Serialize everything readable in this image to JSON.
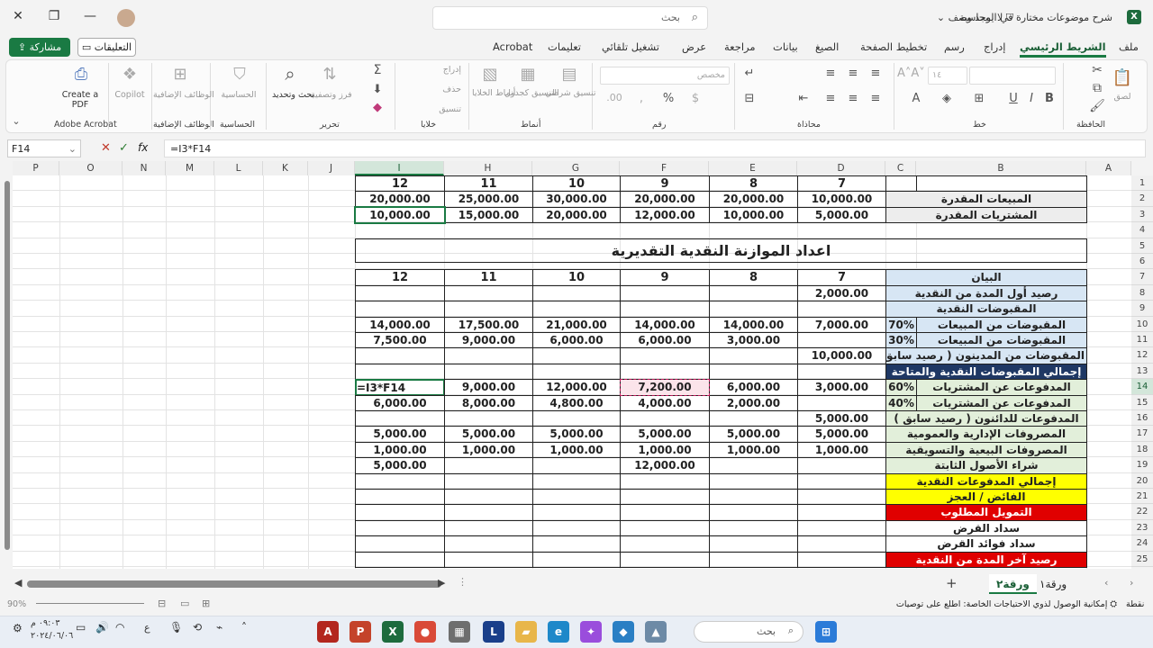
{
  "window": {
    "title": "شرح موضوعات مختارة في المحاسبة",
    "sensitivity": "لا يوجد وصف",
    "search_placeholder": "بحث",
    "app_logo": "X"
  },
  "tabs": [
    "ملف",
    "الشريط الرئيسي",
    "إدراج",
    "رسم",
    "تخطيط الصفحة",
    "الصيغ",
    "بيانات",
    "مراجعة",
    "عرض",
    "تشغيل تلقائي",
    "تعليمات",
    "Acrobat"
  ],
  "actions": {
    "share": "مشاركة",
    "comments": "التعليقات"
  },
  "ribbon": {
    "groups": [
      "الحافظة",
      "خط",
      "محاذاة",
      "رقم",
      "أنماط",
      "خلايا",
      "تحرير",
      "الحساسية",
      "الوظائف الإضافية",
      "Adobe Acrobat"
    ],
    "paste": "لصق",
    "font_size": "١٤",
    "number_format": "مخصص",
    "cond_format": "تنسيق شرطي",
    "format_table": "التنسيق كجدول",
    "cell_styles": "أنماط الخلايا",
    "insert": "إدراج",
    "delete": "حذف",
    "format": "تنسيق",
    "sort_filter": "فرز وتصفية",
    "find_select": "بحث وتحديد",
    "sensitivity": "الحساسية",
    "addins": "الوظائف الإضافية",
    "copilot": "Copilot",
    "create_pdf": "Create a PDF"
  },
  "formula_bar": {
    "name_box": "F14",
    "formula": "=I3*F14",
    "fx": "fx"
  },
  "columns": [
    "P",
    "O",
    "N",
    "M",
    "L",
    "K",
    "J",
    "I",
    "H",
    "G",
    "F",
    "E",
    "D",
    "C",
    "B",
    "A"
  ],
  "rows": [
    "1",
    "2",
    "3",
    "4",
    "5",
    "6",
    "7",
    "8",
    "9",
    "10",
    "11",
    "12",
    "13",
    "14",
    "15",
    "16",
    "17",
    "18",
    "19",
    "20",
    "21",
    "22",
    "23",
    "24",
    "25"
  ],
  "sheet": {
    "months": [
      "12",
      "11",
      "10",
      "9",
      "8",
      "7"
    ],
    "sales_label": "المبيعات المقدرة",
    "sales": [
      "20,000.00",
      "25,000.00",
      "30,000.00",
      "20,000.00",
      "20,000.00",
      "10,000.00"
    ],
    "purchases_label": "المشتريات المقدرة",
    "purchases": [
      "10,000.00",
      "15,000.00",
      "20,000.00",
      "12,000.00",
      "10,000.00",
      "5,000.00"
    ],
    "title": "اعداد الموازنة النقدية التقديرية",
    "desc_header": "البيان",
    "labels": [
      "رصيد أول المدة من النقدية",
      "المقبوضات النقدية",
      "المقبوضات من المبيعات",
      "المقبوضات من المبيعات",
      "المقبوضات من المدينون ( رصيد سابق )",
      "إجمالي المقبوضات النقدية والمتاحة",
      "المدفوعات عن المشتريات",
      "المدفوعات عن المشتريات",
      "المدفوعات للدائنون ( رصيد سابق )",
      "المصروفات الإدارية والعمومية",
      "المصروفات البيعية والتسويقية",
      "شراء الأصول الثابتة",
      "إجمالي المدفوعات النقدية",
      "الفائض / العجز",
      "التمويل المطلوب",
      "سداد القرض",
      "سداد فوائد القرض",
      "رصيد آخر المدة من النقدية"
    ],
    "pct": {
      "r10": "70%",
      "r11": "30%",
      "r14": "60%",
      "r15": "40%"
    },
    "r8": [
      "",
      "",
      "",
      "",
      "",
      "2,000.00"
    ],
    "r10": [
      "14,000.00",
      "17,500.00",
      "21,000.00",
      "14,000.00",
      "14,000.00",
      "7,000.00"
    ],
    "r11": [
      "7,500.00",
      "9,000.00",
      "6,000.00",
      "6,000.00",
      "3,000.00",
      ""
    ],
    "r12": [
      "",
      "",
      "",
      "",
      "",
      "10,000.00"
    ],
    "r14": [
      "=I3*F14",
      "9,000.00",
      "12,000.00",
      "7,200.00",
      "6,000.00",
      "3,000.00"
    ],
    "r15": [
      "6,000.00",
      "8,000.00",
      "4,800.00",
      "4,000.00",
      "2,000.00",
      ""
    ],
    "r16": [
      "",
      "",
      "",
      "",
      "",
      "5,000.00"
    ],
    "r17": [
      "5,000.00",
      "5,000.00",
      "5,000.00",
      "5,000.00",
      "5,000.00",
      "5,000.00"
    ],
    "r18": [
      "1,000.00",
      "1,000.00",
      "1,000.00",
      "1,000.00",
      "1,000.00",
      "1,000.00"
    ],
    "r19": [
      "5,000.00",
      "",
      "",
      "12,000.00",
      "",
      ""
    ]
  },
  "sheet_tabs": [
    "ورقة٢",
    "ورقة١"
  ],
  "status": {
    "left": "نقطة",
    "accessibility": "إمكانية الوصول لذوي الاحتياجات الخاصة: اطلع على توصيات",
    "zoom": "90%"
  },
  "taskbar": {
    "search": "بحث",
    "time": "٠٩:٠٣ م",
    "date": "٢٠٢٤/٠٦/٠٦",
    "lang": "ع"
  },
  "colors": {
    "accent": "#1a7a43",
    "blue_light": "#d7e6f4",
    "navy": "#1f3864",
    "green_light": "#e2efda",
    "yellow": "#ffff00",
    "red": "#e00000",
    "pink": "#fbe4ea"
  }
}
